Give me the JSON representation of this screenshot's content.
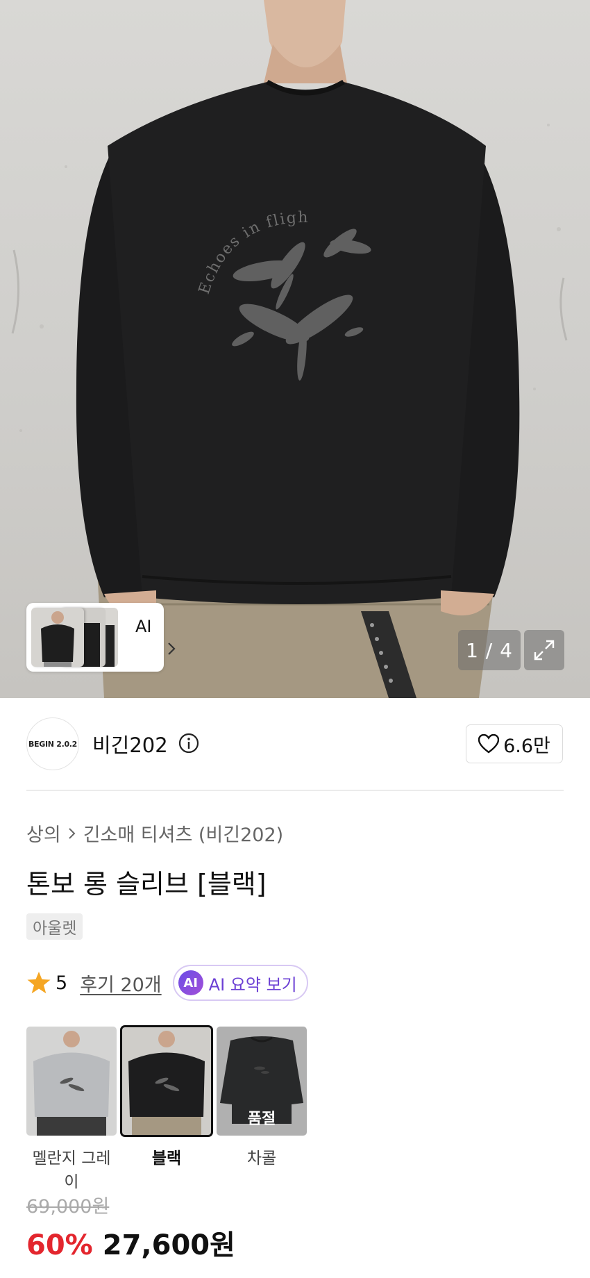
{
  "hero": {
    "print_text": "Echoes in flight.",
    "counter": "1 / 4",
    "ai_label": "AI"
  },
  "brand": {
    "logo_text": "BEGIN 2.0.2",
    "name": "비긴202",
    "likes": "6.6만"
  },
  "product": {
    "breadcrumb": [
      "상의",
      "긴소매 티셔츠 (비긴202)"
    ],
    "title": "톤보 롱 슬리브 [블랙]",
    "tag": "아울렛",
    "rating": "5",
    "reviews": "후기 20개",
    "ai_badge": "AI",
    "ai_summary": "AI 요약 보기"
  },
  "options": [
    {
      "name": "멜란지 그레이",
      "selected": false,
      "soldout": ""
    },
    {
      "name": "블랙",
      "selected": true,
      "soldout": ""
    },
    {
      "name": "차콜",
      "selected": false,
      "soldout": "품절"
    }
  ],
  "price": {
    "original": "69,000원",
    "discount": "60%",
    "final": "27,600원"
  },
  "colors": {
    "discount_red": "#e3262e",
    "ai_purple": "#6b3fd4",
    "star_orange": "#f5a623"
  },
  "icons": [
    "chevron-right-icon",
    "expand-icon",
    "info-icon",
    "heart-icon",
    "star-icon"
  ]
}
